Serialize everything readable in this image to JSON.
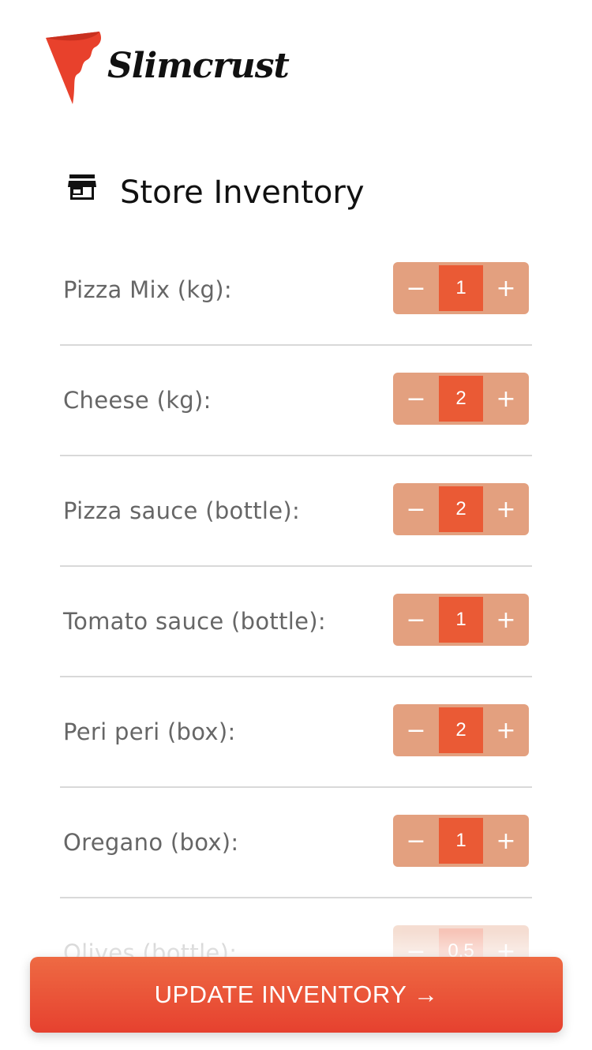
{
  "brand": {
    "name": "Slimcrust",
    "logo_icon": "pizza-slice-icon",
    "accent": "#ea5a35"
  },
  "heading": {
    "icon": "store-icon",
    "title": "Store Inventory"
  },
  "inventory": [
    {
      "label": "Pizza Mix (kg):",
      "value": "1"
    },
    {
      "label": "Cheese (kg):",
      "value": "2"
    },
    {
      "label": "Pizza sauce (bottle):",
      "value": "2"
    },
    {
      "label": "Tomato sauce (bottle):",
      "value": "1"
    },
    {
      "label": "Peri peri (box):",
      "value": "2"
    },
    {
      "label": "Oregano (box):",
      "value": "1"
    },
    {
      "label": "Olives (bottle):",
      "value": "0.5"
    }
  ],
  "stepper": {
    "decrement": "−",
    "increment": "+"
  },
  "actions": {
    "update_label": "UPDATE INVENTORY →"
  }
}
